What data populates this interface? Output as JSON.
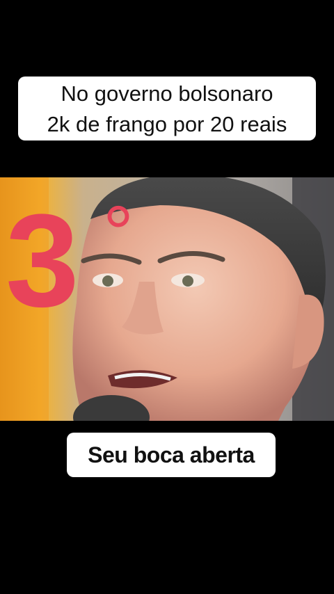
{
  "caption_top": {
    "line1": "No governo bolsonaro",
    "line2": "2k de frango por 20 reais"
  },
  "overlay_graphic": {
    "digit": "3",
    "degree": "°",
    "color": "#e8435a"
  },
  "caption_bottom": {
    "text": "Seu boca aberta"
  },
  "colors": {
    "background": "#000000",
    "caption_bg": "#ffffff",
    "caption_text": "#111111"
  }
}
